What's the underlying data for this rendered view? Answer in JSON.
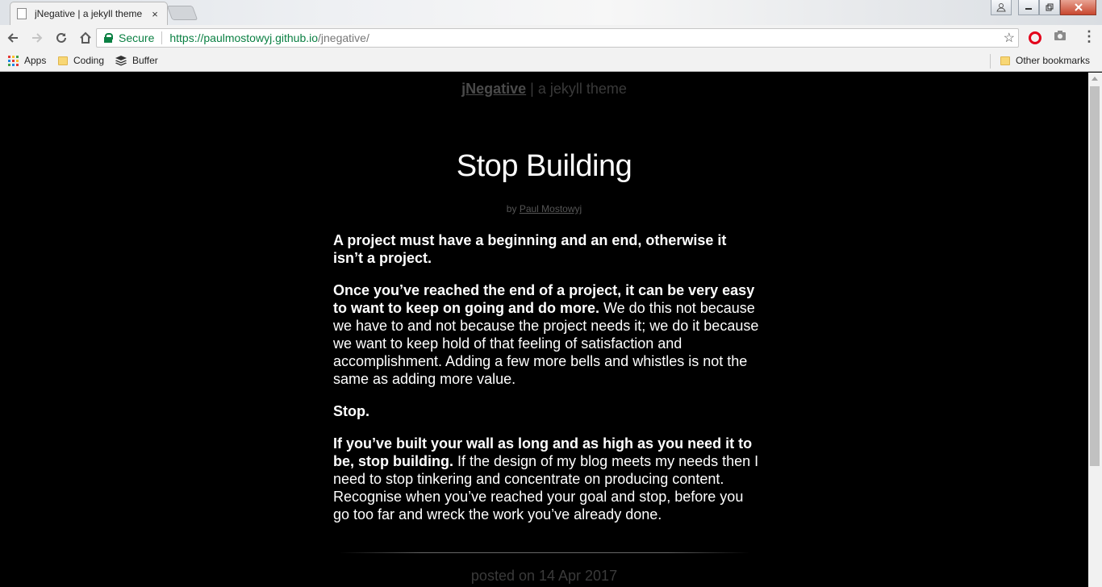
{
  "browser": {
    "tab_title": "jNegative | a jekyll theme",
    "tab_close": "×",
    "secure_label": "Secure",
    "url_base": "https://paulmostowyj.github.io",
    "url_path": "/jnegative/",
    "bookmarks": {
      "apps": "Apps",
      "coding": "Coding",
      "buffer": "Buffer",
      "other": "Other bookmarks"
    }
  },
  "page": {
    "site_name": "jNegative",
    "site_tagline": " | a jekyll theme",
    "post_title": "Stop Building",
    "byline_prefix": "by ",
    "author": "Paul Mostowyj",
    "p1_bold": "A project must have a beginning and an end, otherwise it isn’t a project.",
    "p2_bold": "Once you’ve reached the end of a project, it can be very easy to want to keep on going and do more.",
    "p2_rest": " We do this not because we have to and not because the project needs it; we do it because we want to keep hold of that feeling of satisfaction and accomplishment. Adding a few more bells and whistles is not the same as adding more value.",
    "p3_bold": "Stop.",
    "p4_bold": "If you’ve built your wall as long and as high as you need it to be, stop building.",
    "p4_rest": " If the design of my blog meets my needs then I need to stop tinkering and concentrate on producing content. Recognise when you’ve reached your goal and stop, before you go too far and wreck the work you’ve already done.",
    "posted": "posted on 14 Apr 2017"
  }
}
